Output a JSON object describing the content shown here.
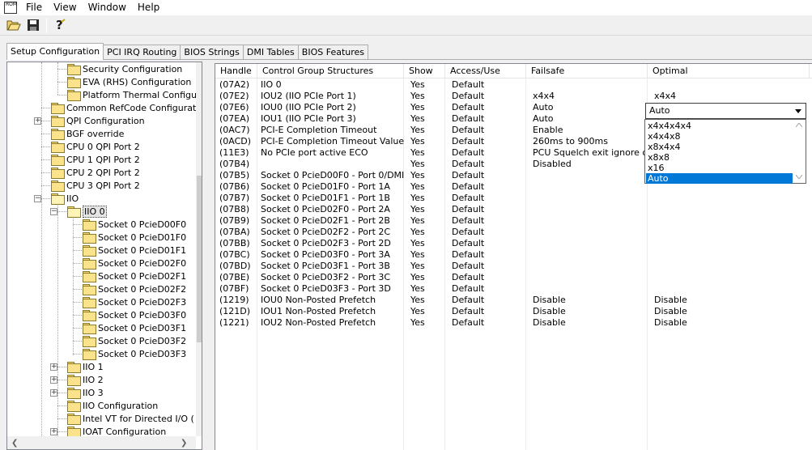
{
  "menubar": {
    "app_icon_label": "ROM",
    "items": [
      "File",
      "View",
      "Window",
      "Help"
    ]
  },
  "toolbar": {
    "buttons": [
      "open-icon",
      "save-icon",
      "help-icon"
    ]
  },
  "tabs": [
    "Setup Configuration",
    "PCI IRQ Routing",
    "BIOS Strings",
    "DMI Tables",
    "BIOS Features"
  ],
  "active_tab": "Setup Configuration",
  "tree": {
    "items": [
      "Security Configuration",
      "EVA (RHS) Configuration",
      "Platform Thermal Configu",
      "Common RefCode Configurati",
      "QPI Configuration",
      "BGF override",
      "CPU 0 QPI Port 2",
      "CPU 1 QPI Port 2",
      "CPU 2 QPI Port 2",
      "CPU 3 QPI Port 2",
      "IIO",
      "IIO 0",
      "Socket 0 PcieD00F0",
      "Socket 0 PcieD01F0",
      "Socket 0 PcieD01F1",
      "Socket 0 PcieD02F0",
      "Socket 0 PcieD02F1",
      "Socket 0 PcieD02F2",
      "Socket 0 PcieD02F3",
      "Socket 0 PcieD03F0",
      "Socket 0 PcieD03F1",
      "Socket 0 PcieD03F2",
      "Socket 0 PcieD03F3",
      "IIO 1",
      "IIO 2",
      "IIO 3",
      "IIO Configuration",
      "Intel VT for Directed I/O (",
      "IOAT Configuration"
    ],
    "selected": "IIO 0",
    "expand_minus": "−",
    "expand_plus": "+"
  },
  "table": {
    "headers": [
      "Handle",
      "Control Group Structures",
      "Show",
      "Access/Use",
      "Failsafe",
      "Optimal"
    ],
    "rows": [
      [
        "(07A2)",
        "IIO 0",
        "Yes",
        "Default",
        "",
        ""
      ],
      [
        "(07E2)",
        "IOU2 (IIO PCIe Port 1)",
        "Yes",
        "Default",
        "x4x4",
        "x4x4"
      ],
      [
        "(07E6)",
        "IOU0 (IIO PCIe Port 2)",
        "Yes",
        "Default",
        "Auto",
        ""
      ],
      [
        "(07EA)",
        "IOU1 (IIO PCIe Port 3)",
        "Yes",
        "Default",
        "Auto",
        ""
      ],
      [
        "(0AC7)",
        "PCI-E Completion Timeout",
        "Yes",
        "Default",
        "Enable",
        ""
      ],
      [
        "(0ACD)",
        "PCI-E Completion Timeout Value",
        "Yes",
        "Default",
        "260ms to 900ms",
        ""
      ],
      [
        "(11E3)",
        "No PCIe port active ECO",
        "Yes",
        "Default",
        "PCU Squelch exit ignore o...",
        ""
      ],
      [
        "(07B4)",
        "",
        "Yes",
        "Default",
        "Disabled",
        ""
      ],
      [
        "(07B5)",
        "Socket 0 PcieD00F0 - Port 0/DMI",
        "Yes",
        "Default",
        "",
        ""
      ],
      [
        "(07B6)",
        "Socket 0 PcieD01F0 - Port 1A",
        "Yes",
        "Default",
        "",
        ""
      ],
      [
        "(07B7)",
        "Socket 0 PcieD01F1 - Port 1B",
        "Yes",
        "Default",
        "",
        ""
      ],
      [
        "(07B8)",
        "Socket 0 PcieD02F0 - Port 2A",
        "Yes",
        "Default",
        "",
        ""
      ],
      [
        "(07B9)",
        "Socket 0 PcieD02F1 - Port 2B",
        "Yes",
        "Default",
        "",
        ""
      ],
      [
        "(07BA)",
        "Socket 0 PcieD02F2 - Port 2C",
        "Yes",
        "Default",
        "",
        ""
      ],
      [
        "(07BB)",
        "Socket 0 PcieD02F3 - Port 2D",
        "Yes",
        "Default",
        "",
        ""
      ],
      [
        "(07BC)",
        "Socket 0 PcieD03F0 - Port 3A",
        "Yes",
        "Default",
        "",
        ""
      ],
      [
        "(07BD)",
        "Socket 0 PcieD03F1 - Port 3B",
        "Yes",
        "Default",
        "",
        ""
      ],
      [
        "(07BE)",
        "Socket 0 PcieD03F2 - Port 3C",
        "Yes",
        "Default",
        "",
        ""
      ],
      [
        "(07BF)",
        "Socket 0 PcieD03F3 - Port 3D",
        "Yes",
        "Default",
        "",
        ""
      ],
      [
        "(1219)",
        "IOU0 Non-Posted Prefetch",
        "Yes",
        "Default",
        "Disable",
        "Disable"
      ],
      [
        "(121D)",
        "IOU1 Non-Posted Prefetch",
        "Yes",
        "Default",
        "Disable",
        "Disable"
      ],
      [
        "(1221)",
        "IOU2 Non-Posted Prefetch",
        "Yes",
        "Default",
        "Disable",
        "Disable"
      ]
    ]
  },
  "dropdown": {
    "value": "Auto",
    "options": [
      "x4x4x4x4",
      "x4x4x8",
      "x8x4x4",
      "x8x8",
      "x16",
      "Auto"
    ],
    "selected": "Auto",
    "selection_color": "#0078d7"
  }
}
